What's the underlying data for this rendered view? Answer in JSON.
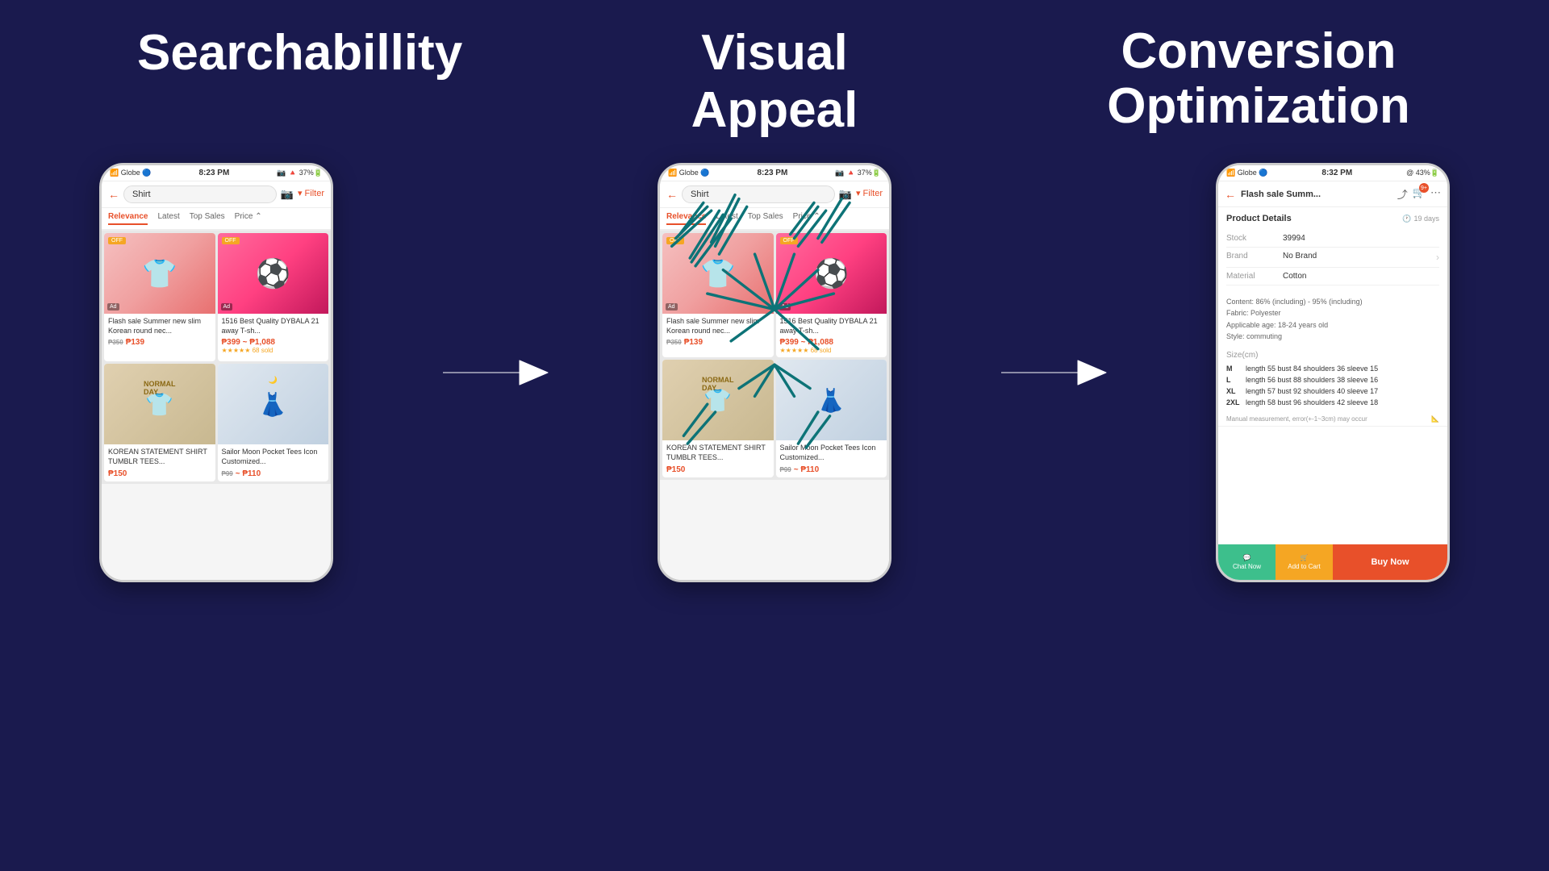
{
  "background": "#1a1a4e",
  "sections": [
    {
      "title": "Searchabillity",
      "id": "searchability"
    },
    {
      "title": "Visual Appeal",
      "id": "visual-appeal"
    },
    {
      "title": "Conversion\nOptimization",
      "id": "conversion-opt"
    }
  ],
  "phone1": {
    "status_bar": {
      "left": "Globe 🔵",
      "center": "8:23 PM",
      "right": "@ ⬆ 37%🔋"
    },
    "search_term": "Shirt",
    "tabs": [
      "Relevance",
      "Latest",
      "Top Sales",
      "Price"
    ],
    "active_tab": "Relevance",
    "products": [
      {
        "title": "Flash sale Summer new slim Korean round nec...",
        "original_price": "₱350",
        "price": "₱139",
        "has_ad": true,
        "has_off": true,
        "image_type": "pink-shirt"
      },
      {
        "title": "1516 Best Quality DYBALA 21 away T-sh...",
        "original_price": "",
        "price": "₱399 ~ ₱1,088",
        "rating": "★★★★★",
        "sold": "68 sold",
        "has_off": true,
        "image_type": "jeep-shirt"
      },
      {
        "title": "KOREAN STATEMENT SHIRT TUMBLR TEES...",
        "original_price": "",
        "price": "₱150",
        "image_type": "normal-day"
      },
      {
        "title": "Sailor Moon Pocket Tees Icon Customized...",
        "original_price": "₱99",
        "price": "₱110",
        "image_type": "sailor-moon"
      }
    ]
  },
  "phone2": {
    "status_bar": {
      "left": "Globe 🔵",
      "center": "8:23 PM",
      "right": "@ ⬆ 37%🔋"
    },
    "search_term": "Shirt",
    "description": "Same as phone 1 but with annotation marks"
  },
  "phone3": {
    "status_bar": {
      "left": "Globe 🔵",
      "center": "8:32 PM",
      "right": "@ 43%🔋"
    },
    "page_title": "Flash sale Summ...",
    "product_details_header": "Product Details",
    "days_label": "19 days",
    "fields": [
      {
        "label": "Stock",
        "value": "39994",
        "has_arrow": false
      },
      {
        "label": "Brand",
        "value": "No Brand",
        "has_arrow": true
      },
      {
        "label": "Material",
        "value": "Cotton",
        "has_arrow": false
      }
    ],
    "additional_info": "Content: 86% (including) - 95% (including)\nFabric: Polyester\nApplicable age: 18-24 years old\nStyle: commuting",
    "size_section_label": "Size(cm)",
    "sizes": [
      {
        "size": "M",
        "length": 55,
        "bust": 84,
        "shoulders": 36,
        "sleeve": 15
      },
      {
        "size": "L",
        "length": 56,
        "bust": 88,
        "shoulders": 38,
        "sleeve": 16
      },
      {
        "size": "XL",
        "length": 57,
        "bust": 92,
        "shoulders": 40,
        "sleeve": 17
      },
      {
        "size": "2XL",
        "length": 58,
        "bust": 96,
        "shoulders": 42,
        "sleeve": 18
      }
    ],
    "measurement_note": "Manual measurement, error(+-1~3cm) may occur",
    "buttons": {
      "chat": "Chat Now",
      "cart": "Add to Cart",
      "buy": "Buy Now"
    }
  },
  "arrows": {
    "arrow1_label": "→",
    "arrow2_label": "→"
  }
}
